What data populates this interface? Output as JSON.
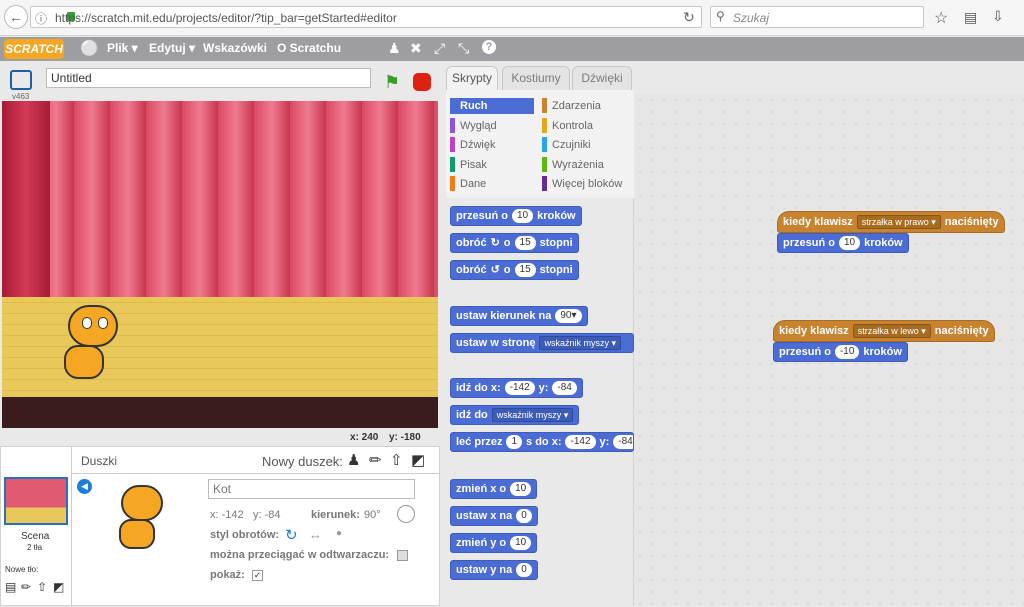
{
  "browser": {
    "url": "https://scratch.mit.edu/projects/editor/?tip_bar=getStarted#editor",
    "search_placeholder": "Szukaj"
  },
  "menu": {
    "logo": "SCRATCH",
    "file": "Plik ▾",
    "edit": "Edytuj ▾",
    "tips": "Wskazówki",
    "about": "O Scratchu"
  },
  "stage": {
    "version": "v463",
    "title": "Untitled",
    "coords_x": "x: 240",
    "coords_y": "y: -180"
  },
  "sprites": {
    "header": "Duszki",
    "new_sprite": "Nowy duszek:",
    "scene": "Scena",
    "scene_bgs": "2 tła",
    "new_bg": "Nowe tło:",
    "name": "Kot",
    "x": "x: -142",
    "y": "y: -84",
    "direction_label": "kierunek:",
    "direction": "90°",
    "rotation_style": "styl obrotów:",
    "draggable": "można przeciągać w odtwarzaczu:",
    "show": "pokaż:"
  },
  "tabs": [
    "Skrypty",
    "Kostiumy",
    "Dźwięki"
  ],
  "categories_left": [
    {
      "label": "Ruch",
      "color": "#4a6cd4"
    },
    {
      "label": "Wygląd",
      "color": "#8a55d7"
    },
    {
      "label": "Dźwięk",
      "color": "#bb42c3"
    },
    {
      "label": "Pisak",
      "color": "#0e9a6c"
    },
    {
      "label": "Dane",
      "color": "#ee7d16"
    }
  ],
  "categories_right": [
    {
      "label": "Zdarzenia",
      "color": "#c88330"
    },
    {
      "label": "Kontrola",
      "color": "#e1a91a"
    },
    {
      "label": "Czujniki",
      "color": "#2ca5e2"
    },
    {
      "label": "Wyrażenia",
      "color": "#5cb712"
    },
    {
      "label": "Więcej bloków",
      "color": "#632d99"
    }
  ],
  "palette": {
    "move_a": "przesuń o",
    "move_b": "10",
    "move_c": "kroków",
    "turn_r_a": "obróć",
    "turn_r_b": "o",
    "turn_r_c": "15",
    "turn_r_d": "stopni",
    "turn_l_a": "obróć",
    "turn_l_b": "o",
    "turn_l_c": "15",
    "turn_l_d": "stopni",
    "point_dir_a": "ustaw kierunek na",
    "point_dir_b": "90▾",
    "point_to_a": "ustaw w stronę",
    "point_to_b": "wskaźnik myszy ▾",
    "goto_xy_a": "idź do x:",
    "goto_xy_b": "-142",
    "goto_xy_c": "y:",
    "goto_xy_d": "-84",
    "goto_a": "idź do",
    "goto_b": "wskaźnik myszy ▾",
    "glide_a": "leć przez",
    "glide_b": "1",
    "glide_c": "s do x:",
    "glide_d": "-142",
    "glide_e": "y:",
    "glide_f": "-84",
    "chx_a": "zmień x o",
    "chx_b": "10",
    "setx_a": "ustaw x na",
    "setx_b": "0",
    "chy_a": "zmień y o",
    "chy_b": "10",
    "sety_a": "ustaw y na",
    "sety_b": "0"
  },
  "scripts": {
    "s1_hat_a": "kiedy klawisz",
    "s1_hat_b": "strzałka w prawo ▾",
    "s1_hat_c": "naciśnięty",
    "s1_move_a": "przesuń o",
    "s1_move_b": "10",
    "s1_move_c": "kroków",
    "s2_hat_a": "kiedy klawisz",
    "s2_hat_b": "strzałka w lewo ▾",
    "s2_hat_c": "naciśnięty",
    "s2_move_a": "przesuń o",
    "s2_move_b": "-10",
    "s2_move_c": "kroków"
  }
}
